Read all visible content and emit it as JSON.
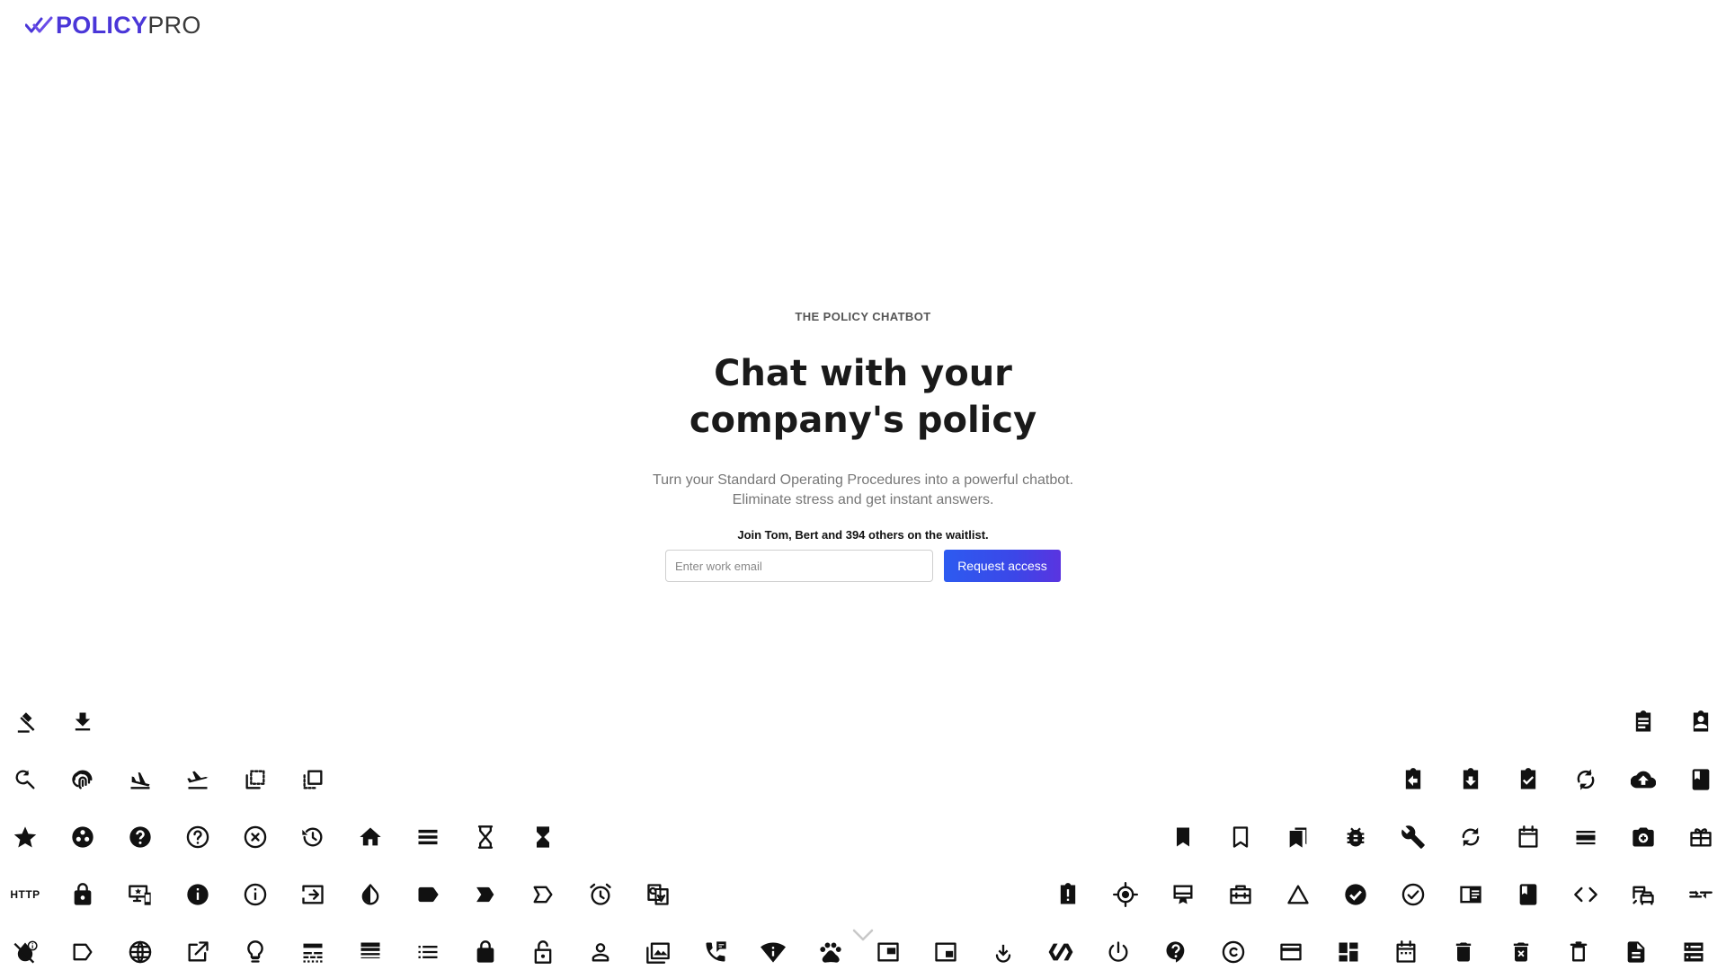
{
  "brand": {
    "name_bold": "POLICY",
    "name_light": "PRO",
    "accent": "#4a36d8"
  },
  "hero": {
    "eyebrow": "THE POLICY CHATBOT",
    "headline": "Chat with your company's policy",
    "subtitle": "Turn your Standard Operating Procedures into a powerful chatbot. Eliminate stress and get instant answers.",
    "waitlist": "Join Tom, Bert and 394 others on the waitlist."
  },
  "form": {
    "email_placeholder": "Enter work email",
    "email_value": "",
    "button_label": "Request access",
    "button_color": "#2d5bf0"
  },
  "icons": {
    "http_label": "HTTP",
    "row1_left": [
      "gavel-icon",
      "download-icon"
    ],
    "row1_right": [
      "clipboard-icon",
      "assignment-ind-icon"
    ],
    "row2_left": [
      "find-replace-icon",
      "fingerprint-icon",
      "flight-land-icon",
      "flight-takeoff-icon",
      "flip-to-back-icon",
      "flip-to-front-icon"
    ],
    "row2_right": [
      "assignment-return-icon",
      "assignment-returned-icon",
      "assignment-turned-in-icon",
      "autorenew-icon",
      "backup-icon",
      "book-icon"
    ],
    "row3_left": [
      "grade-icon",
      "group-work-icon",
      "help-icon",
      "help-outline-icon",
      "highlight-off-icon",
      "history-icon",
      "home-icon",
      "horizontal-split-icon",
      "hourglass-empty-icon",
      "hourglass-full-icon"
    ],
    "row3_right": [
      "bookmark-icon",
      "bookmark-border-icon",
      "bookmarks-icon",
      "bug-report-icon",
      "build-icon",
      "cached-icon",
      "calendar-today-icon",
      "calendar-view-day-icon",
      "camera-enhance-icon",
      "card-giftcard-icon"
    ],
    "row4_left": [
      "http-icon",
      "https-icon",
      "important-devices-icon",
      "info-icon",
      "info-outline-icon",
      "input-icon",
      "invert-colors-icon",
      "label-icon",
      "label-important-icon",
      "label-outline-icon",
      "alarm-icon",
      "g-translate-icon"
    ],
    "row4_right": [
      "assignment-late-icon",
      "gps-fixed-icon",
      "card-membership-icon",
      "card-travel-icon",
      "change-history-icon",
      "check-circle-icon",
      "check-circle-outline-icon",
      "chrome-reader-mode-icon",
      "class-icon",
      "code-icon",
      "commute-icon",
      "compare-arrows-icon"
    ],
    "row5": [
      "invert-colors-off-icon",
      "label-off-icon",
      "language-icon",
      "launch-icon",
      "lightbulb-outline-icon",
      "line-style-icon",
      "line-weight-icon",
      "list-icon",
      "lock-icon",
      "lock-open-icon",
      "perm-identity-icon",
      "perm-media-icon",
      "perm-phone-msg-icon",
      "perm-scan-wifi-icon",
      "pets-icon",
      "picture-in-picture-icon",
      "picture-in-picture-alt-icon",
      "play-for-work-icon",
      "polymer-icon",
      "power-settings-icon",
      "contact-support-icon",
      "copyright-icon",
      "credit-card-icon",
      "dashboard-icon",
      "date-range-icon",
      "delete-icon",
      "delete-forever-icon",
      "delete-outline-icon",
      "description-icon",
      "dns-icon"
    ]
  }
}
